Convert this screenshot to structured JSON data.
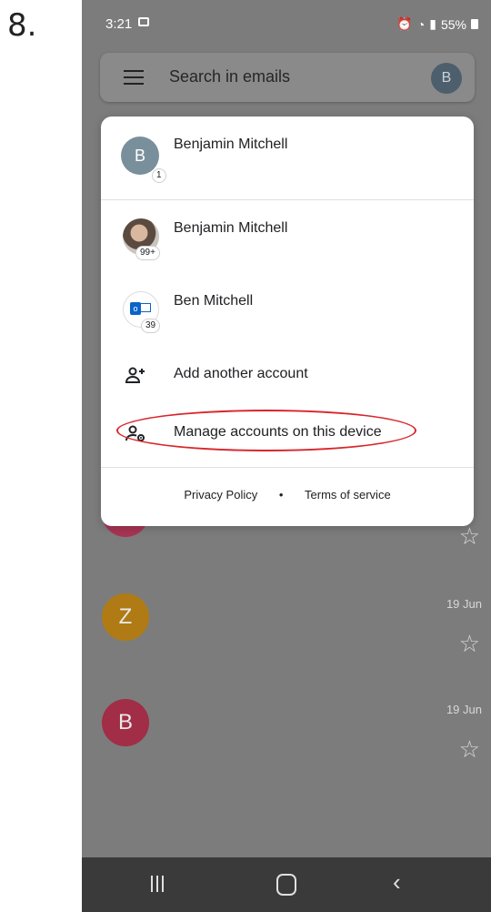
{
  "step_label": "8.",
  "status": {
    "time": "3:21",
    "right": "55%",
    "icons": [
      "alarm-icon",
      "wifi-icon",
      "signal-icon",
      "battery-icon"
    ]
  },
  "search": {
    "placeholder": "Search in emails",
    "avatar_letter": "B"
  },
  "accounts": {
    "primary": {
      "name": "Benjamin Mitchell",
      "avatar_letter": "B",
      "badge": "1"
    },
    "others": [
      {
        "name": "Benjamin Mitchell",
        "badge": "99+",
        "avatar": "photo"
      },
      {
        "name": "Ben Mitchell",
        "badge": "39",
        "avatar": "outlook-icon"
      }
    ],
    "actions": [
      {
        "label": "Add another account",
        "icon": "add-person-icon"
      },
      {
        "label": "Manage accounts on this device",
        "icon": "manage-accounts-icon"
      }
    ],
    "footer": {
      "privacy": "Privacy Policy",
      "separator": "•",
      "terms": "Terms of service"
    }
  },
  "background_list": [
    {
      "letter": "",
      "date": "",
      "color": "#b23a5a"
    },
    {
      "letter": "Z",
      "date": "19 Jun",
      "color": "#b8860b"
    },
    {
      "letter": "B",
      "date": "19 Jun",
      "color": "#b0324a"
    }
  ],
  "colors": {
    "highlight": "#d8262c",
    "avatar_primary": "#7a8f9c"
  }
}
